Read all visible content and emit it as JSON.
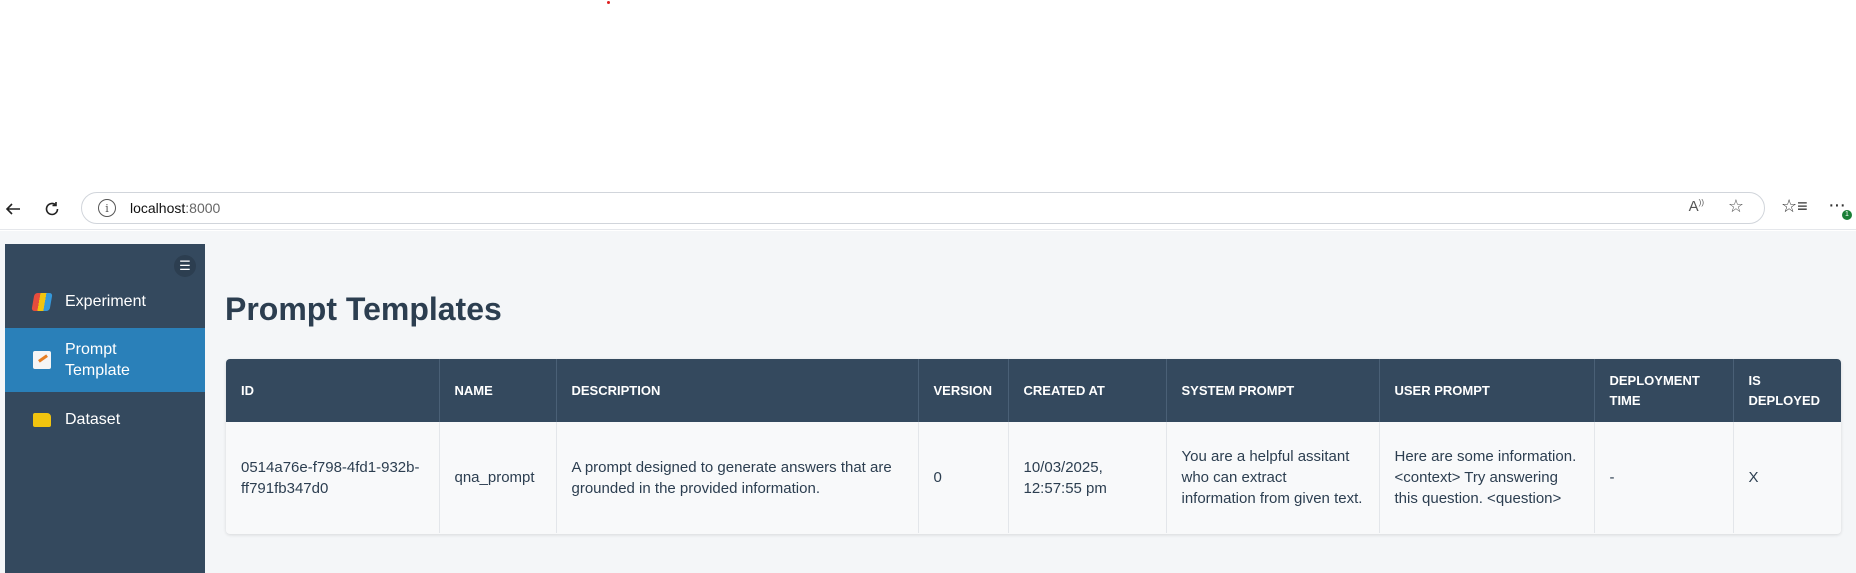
{
  "browser": {
    "url_host": "localhost",
    "url_port": ":8000",
    "notification_count": "1"
  },
  "sidebar": {
    "items": [
      {
        "label": "Experiment",
        "icon": "chart-icon"
      },
      {
        "label": "Prompt Template",
        "icon": "document-pen-icon"
      },
      {
        "label": "Dataset",
        "icon": "folder-icon"
      }
    ],
    "active_index": 1,
    "colors": {
      "background": "#34495e",
      "active": "#2a80b9"
    }
  },
  "main": {
    "title": "Prompt Templates",
    "table": {
      "headers": [
        "ID",
        "NAME",
        "DESCRIPTION",
        "VERSION",
        "CREATED AT",
        "SYSTEM PROMPT",
        "USER PROMPT",
        "DEPLOYMENT TIME",
        "IS DEPLOYED"
      ],
      "rows": [
        [
          "0514a76e-f798-4fd1-932b-ff791fb347d0",
          "qna_prompt",
          "A prompt designed to generate answers that are grounded in the provided information.",
          "0",
          "10/03/2025, 12:57:55 pm",
          "You are a helpful assitant who can extract information from given text.",
          "Here are some information. <context> Try answering this question. <question>",
          "-",
          "X"
        ]
      ]
    }
  }
}
